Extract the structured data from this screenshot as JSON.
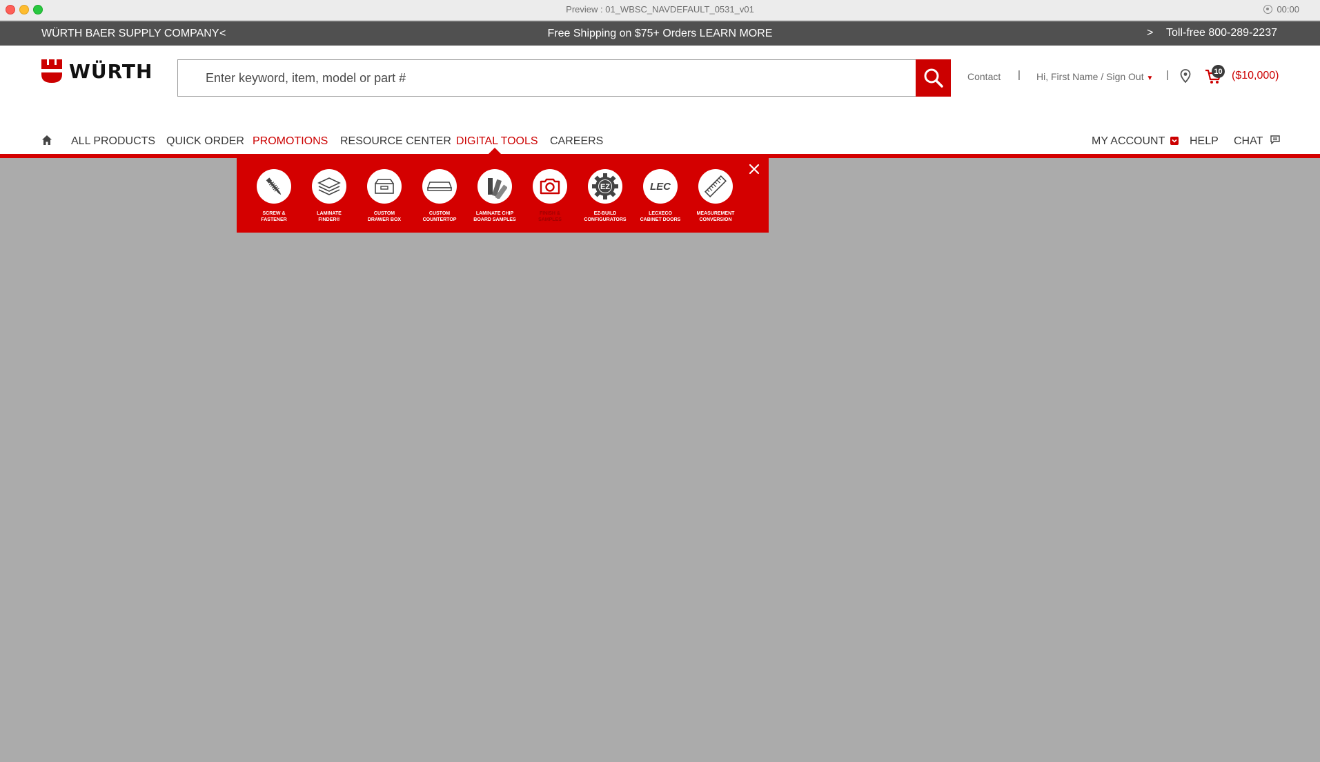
{
  "window": {
    "title": "Preview : 01_WBSC_NAVDEFAULT_0531_v01",
    "timer": "00:00"
  },
  "promo_bar": {
    "company": "WÜRTH BAER SUPPLY COMPANY",
    "prev_arrow": "<",
    "shipping_text": "Free Shipping on $75+ Orders LEARN MORE",
    "next_arrow": ">",
    "phone": "Toll-free 800-289-2237"
  },
  "header": {
    "logo_text": "WÜRTH",
    "search_placeholder": "Enter keyword, item, model or part #",
    "contact": "Contact",
    "separator": "|",
    "user": "Hi, First Name / Sign Out",
    "cart_count": "10",
    "cart_total": "($10,000)"
  },
  "nav": {
    "items": [
      {
        "label": "ALL PRODUCTS"
      },
      {
        "label": "QUICK ORDER"
      },
      {
        "label": "PROMOTIONS"
      },
      {
        "label": "RESOURCE CENTER"
      },
      {
        "label": "DIGITAL TOOLS"
      },
      {
        "label": "CAREERS"
      }
    ],
    "right": {
      "my_account": "MY ACCOUNT",
      "help": "HELP",
      "chat": "CHAT"
    }
  },
  "digital_tools": {
    "items": [
      {
        "label": "SCREW &\nFASTENER",
        "icon": "screw-icon"
      },
      {
        "label": "LAMINATE\nFINDER©",
        "icon": "laminate-layers-icon"
      },
      {
        "label": "CUSTOM\nDRAWER BOX",
        "icon": "drawer-box-icon"
      },
      {
        "label": "CUSTOM\nCOUNTERTOP",
        "icon": "countertop-icon"
      },
      {
        "label": "LAMINATE CHIP\nBOARD SAMPLES",
        "icon": "swatch-fan-icon"
      },
      {
        "label": "FINISH &\nSAMPLES",
        "icon": "camera-icon"
      },
      {
        "label": "EZ-BUILD\nCONFIGURATORS",
        "icon": "ez-gear-icon"
      },
      {
        "label": "LECXECO\nCABINET DOORS",
        "icon": "lec-logo-icon"
      },
      {
        "label": "MEASUREMENT\nCONVERSION",
        "icon": "ruler-icon"
      }
    ]
  },
  "colors": {
    "brand_red": "#cc0000",
    "promo_bar": "#505050",
    "page_overlay": "#ababab"
  }
}
